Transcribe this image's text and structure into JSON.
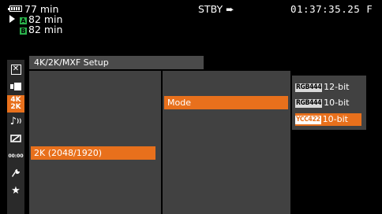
{
  "status": {
    "battery_time": "77 min",
    "slot_a_label": "A",
    "slot_a_time": "82 min",
    "slot_b_label": "B",
    "slot_b_time": "82 min",
    "mode": "STBY",
    "mode_arrow": "➨",
    "timecode": "01:37:35.25 F"
  },
  "tabs": [
    {
      "icon": "close-icon",
      "glyph": "✕"
    },
    {
      "icon": "camera-icon",
      "glyph": "▶"
    },
    {
      "icon": "4k-2k-icon",
      "glyph": "4K 2K"
    },
    {
      "icon": "audio-icon",
      "glyph": "♪"
    },
    {
      "icon": "display-icon",
      "glyph": "▱"
    },
    {
      "icon": "timecode-icon",
      "glyph": "00:00"
    },
    {
      "icon": "wrench-icon",
      "glyph": "🔧"
    },
    {
      "icon": "star-icon",
      "glyph": "★"
    }
  ],
  "active_tab": "4k-2k-icon",
  "menu": {
    "title": "4K/2K/MXF Setup",
    "level1_selected": "2K (2048/1920)",
    "level2_selected": "Mode",
    "options": [
      {
        "tag": "RGB444",
        "label": "12-bit",
        "selected": false
      },
      {
        "tag": "RGB444",
        "label": "10-bit",
        "selected": false
      },
      {
        "tag": "YCC422",
        "label": "10-bit",
        "selected": true
      }
    ]
  },
  "colors": {
    "accent": "#e8701c",
    "slot": "#2bb24c",
    "panel": "#414141"
  }
}
